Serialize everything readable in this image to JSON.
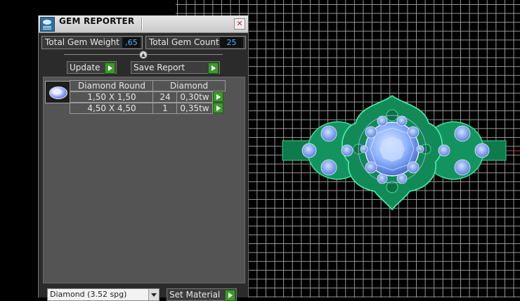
{
  "panel": {
    "title": "GEM REPORTER",
    "close_glyph": "✕",
    "total_weight_label": "Total Gem Weight",
    "total_weight_value": ",65",
    "total_count_label": "Total Gem Count",
    "total_count_value": "25",
    "update_label": "Update",
    "save_report_label": "Save Report",
    "table": {
      "headers": [
        "Diamond Round",
        "Diamond"
      ],
      "rows": [
        {
          "size": "1,50 X 1,50",
          "count": "24",
          "weight": "0,30tw"
        },
        {
          "size": "4,50 X 4,50",
          "count": "1",
          "weight": "0,35tw"
        }
      ]
    },
    "material_value": "Diamond    (3.52 spg)",
    "set_material_label": "Set Material"
  },
  "colors": {
    "panel_bg": "#2b2b2b",
    "list_bg": "#545454",
    "value_text": "#55b4ff",
    "play_green": "#3c9a2a",
    "grid_line": "#9a9a9a",
    "ring_metal": "#1aa06a",
    "gem_blue": "#8fb4ff"
  },
  "icons": {
    "app": "gem-reporter-icon",
    "close": "close-icon",
    "play": "play-arrow-icon",
    "dropdown": "chevron-down-icon"
  }
}
